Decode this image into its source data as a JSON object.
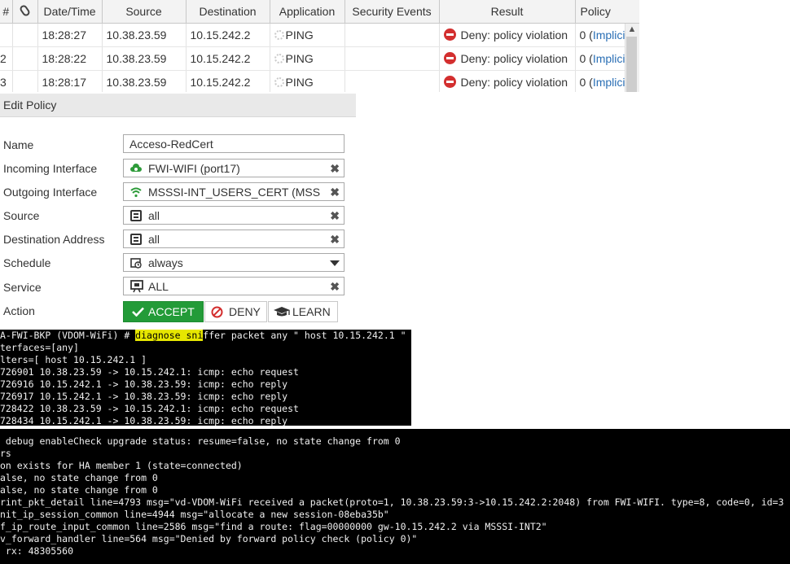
{
  "log_table": {
    "columns": [
      "#",
      "",
      "Date/Time",
      "Source",
      "Destination",
      "Application",
      "Security Events",
      "Result",
      "Policy"
    ],
    "rows": [
      {
        "num": "",
        "time": "18:28:27",
        "source": "10.38.23.59",
        "destination": "10.15.242.2",
        "application": "PING",
        "security": "",
        "result": "Deny: policy violation",
        "policy_num": "0 (",
        "policy_link": "Implicit"
      },
      {
        "num": "2",
        "time": "18:28:22",
        "source": "10.38.23.59",
        "destination": "10.15.242.2",
        "application": "PING",
        "security": "",
        "result": "Deny: policy violation",
        "policy_num": "0 (",
        "policy_link": "Implicit"
      },
      {
        "num": "3",
        "time": "18:28:17",
        "source": "10.38.23.59",
        "destination": "10.15.242.2",
        "application": "PING",
        "security": "",
        "result": "Deny: policy violation",
        "policy_num": "0 (",
        "policy_link": "Implicit"
      }
    ]
  },
  "edit_policy": {
    "title": "Edit Policy",
    "fields": {
      "name": {
        "label": "Name",
        "value": "Acceso-RedCert"
      },
      "incoming": {
        "label": "Incoming Interface",
        "value": "FWI-WIFI (port17)",
        "icon": "cloud-interface-icon"
      },
      "outgoing": {
        "label": "Outgoing Interface",
        "value": "MSSSI-INT_USERS_CERT (MSS",
        "icon": "wifi-icon"
      },
      "source": {
        "label": "Source",
        "value": "all",
        "icon": "address-list-icon"
      },
      "destination": {
        "label": "Destination Address",
        "value": "all",
        "icon": "address-list-icon"
      },
      "schedule": {
        "label": "Schedule",
        "value": "always",
        "icon": "calendar-clock-icon"
      },
      "service": {
        "label": "Service",
        "value": "ALL",
        "icon": "service-monitor-icon"
      }
    },
    "action": {
      "label": "Action",
      "accept": "ACCEPT",
      "deny": "DENY",
      "learn": "LEARN",
      "selected": "ACCEPT"
    }
  },
  "terminal_sniffer": {
    "prompt": "A-FWI-BKP (VDOM-WiFi) # ",
    "command_highlight": "diagnose sni",
    "command_rest": "ffer packet any \" host 10.15.242.1 \"",
    "lines": [
      "terfaces=[any]",
      "lters=[ host 10.15.242.1 ]",
      "726901 10.38.23.59 -> 10.15.242.1: icmp: echo request",
      "726916 10.15.242.1 -> 10.38.23.59: icmp: echo reply",
      "726917 10.15.242.1 -> 10.38.23.59: icmp: echo reply",
      "728422 10.38.23.59 -> 10.15.242.1: icmp: echo request",
      "728434 10.15.242.1 -> 10.38.23.59: icmp: echo reply"
    ]
  },
  "terminal_debug": {
    "lines": [
      " debug enableCheck upgrade status: resume=false, no state change from 0",
      "rs",
      "on exists for HA member 1 (state=connected)",
      "alse, no state change from 0",
      "alse, no state change from 0",
      "rint_pkt_detail line=4793 msg=\"vd-VDOM-WiFi received a packet(proto=1, 10.38.23.59:3->10.15.242.2:2048) from FWI-WIFI. type=8, code=0, id=3",
      "nit_ip_session_common line=4944 msg=\"allocate a new session-08eba35b\"",
      "f_ip_route_input_common line=2586 msg=\"find a route: flag=00000000 gw-10.15.242.2 via MSSSI-INT2\"",
      "v_forward_handler line=564 msg=\"Denied by forward policy check (policy 0)\"",
      " rx: 48305560"
    ]
  }
}
